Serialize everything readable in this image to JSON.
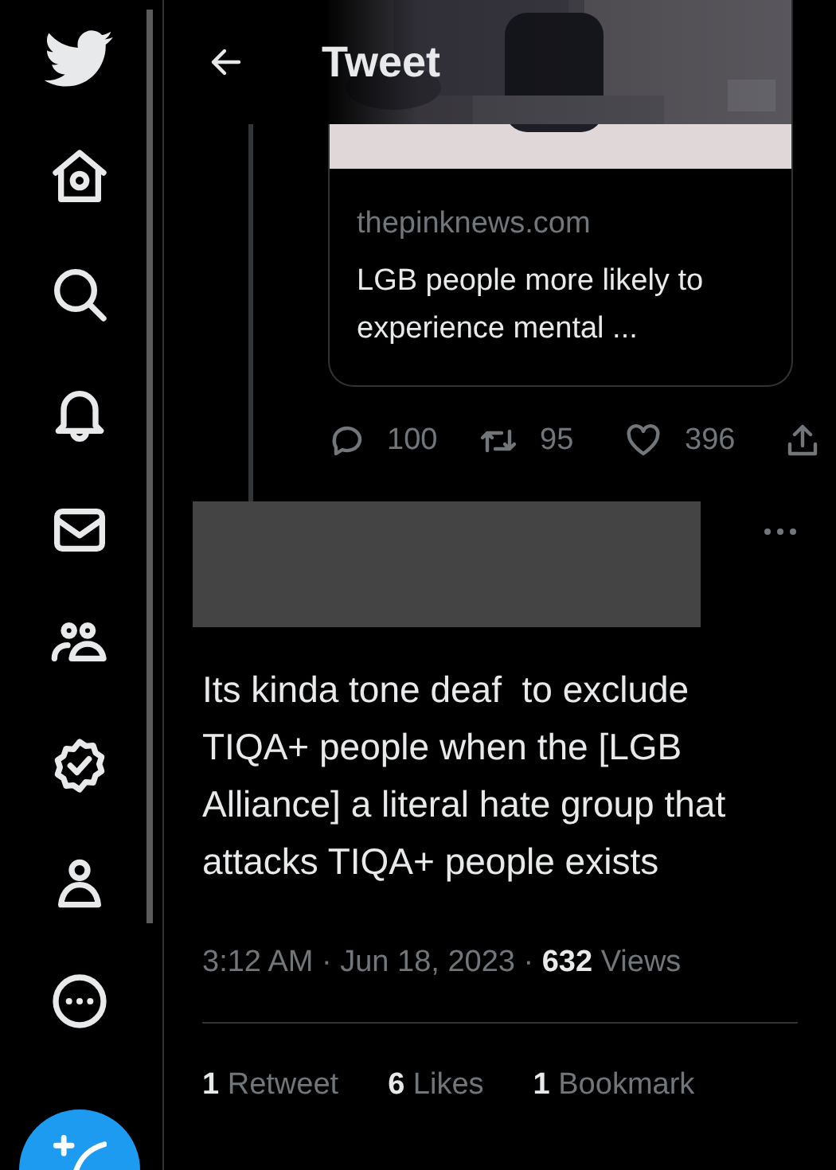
{
  "header": {
    "title": "Tweet"
  },
  "quoted_card": {
    "domain": "thepinknews.com",
    "title": "LGB people more likely to experience mental ..."
  },
  "actions": [
    {
      "kind": "reply",
      "count": "100"
    },
    {
      "kind": "retweet",
      "count": "95"
    },
    {
      "kind": "like",
      "count": "396"
    },
    {
      "kind": "share"
    }
  ],
  "tweet": {
    "author": {
      "kind": "redacted"
    },
    "text": "Its kinda tone deaf  to exclude TIQA+ people when the [LGB Alliance] a literal hate group that attacks TIQA+ people exists",
    "meta": "3:12 AM · Jun 18, 2023 · **632** Views"
  },
  "stats": [
    {
      "text": "**1** Retweet"
    },
    {
      "text": "**6** Likes"
    },
    {
      "text": "**1** Bookmark"
    }
  ]
}
